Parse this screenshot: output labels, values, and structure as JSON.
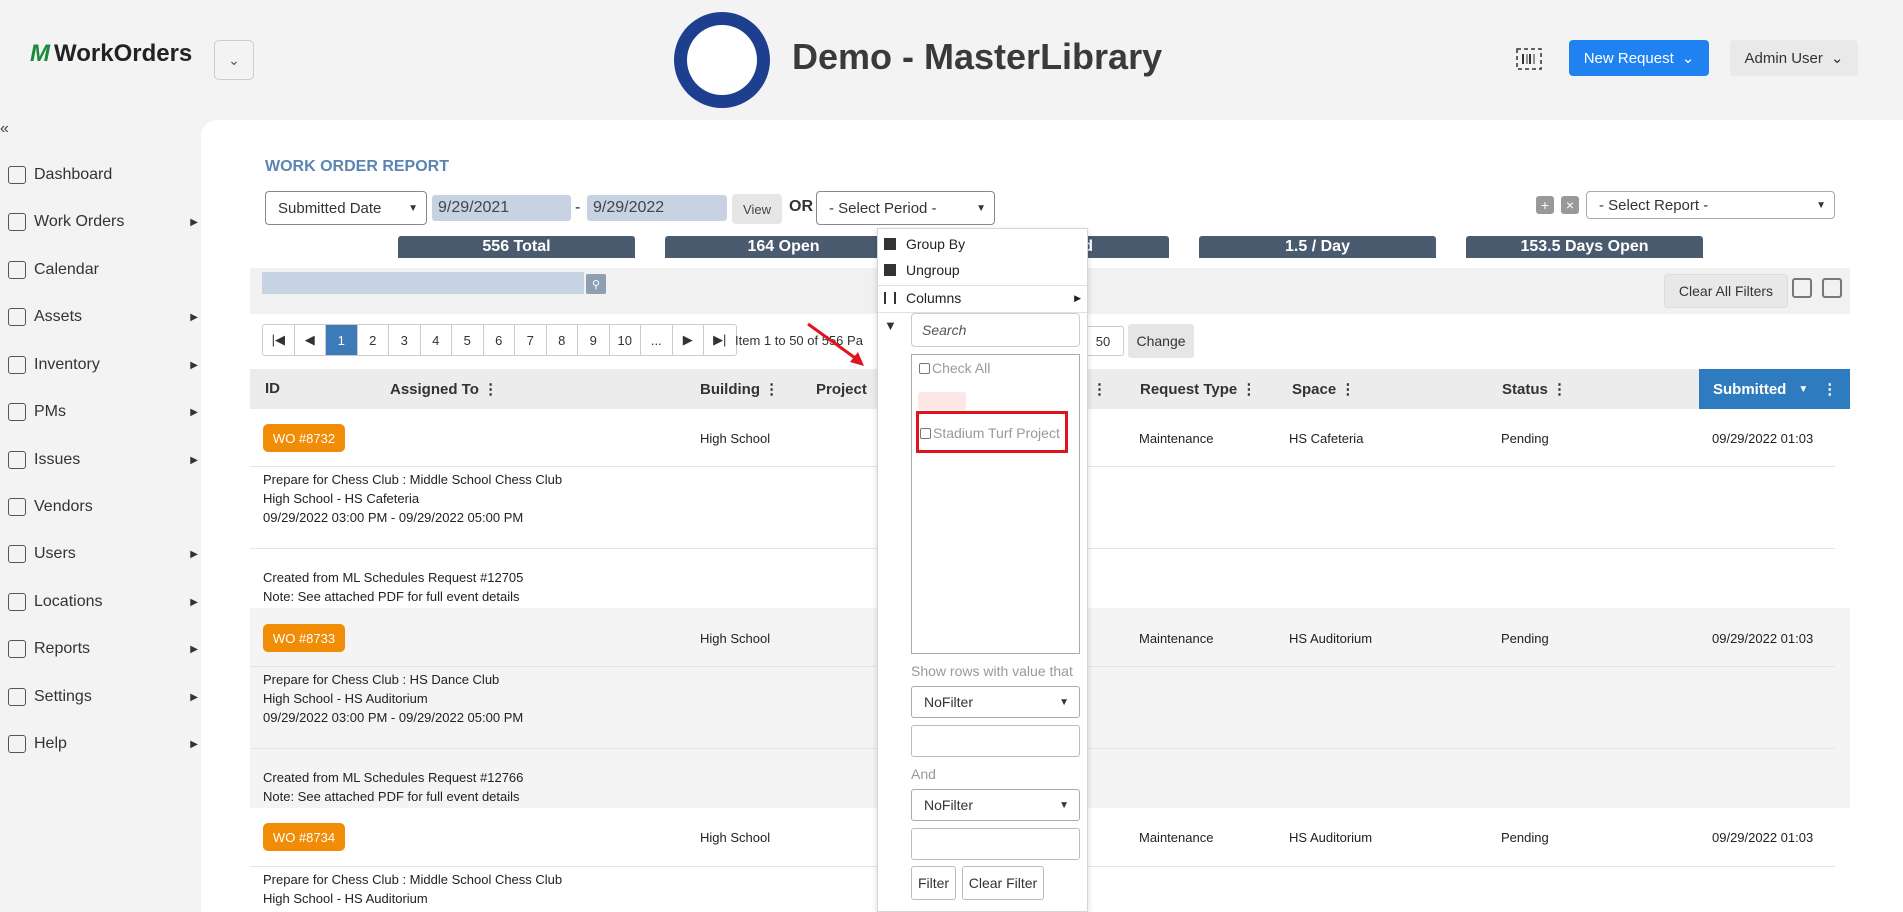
{
  "header": {
    "logo_text": "WorkOrders",
    "site_title": "Demo - MasterLibrary",
    "new_request": "New Request",
    "user": "Admin User"
  },
  "sidebar": {
    "items": [
      {
        "label": "Dashboard",
        "arrow": false
      },
      {
        "label": "Work Orders",
        "arrow": true
      },
      {
        "label": "Calendar",
        "arrow": false
      },
      {
        "label": "Assets",
        "arrow": true
      },
      {
        "label": "Inventory",
        "arrow": true
      },
      {
        "label": "PMs",
        "arrow": true
      },
      {
        "label": "Issues",
        "arrow": true
      },
      {
        "label": "Vendors",
        "arrow": false
      },
      {
        "label": "Users",
        "arrow": true
      },
      {
        "label": "Locations",
        "arrow": true
      },
      {
        "label": "Reports",
        "arrow": true
      },
      {
        "label": "Settings",
        "arrow": true
      },
      {
        "label": "Help",
        "arrow": true
      }
    ]
  },
  "report": {
    "title": "WORK ORDER REPORT",
    "date_field": "Submitted Date",
    "date_from": "9/29/2021",
    "date_sep": "-",
    "date_to": "9/29/2022",
    "view": "View",
    "or": "OR",
    "period": "- Select Period -",
    "select_report": "- Select Report -",
    "stats": [
      "556 Total",
      "164 Open",
      "d",
      "1.5 / Day",
      "153.5 Days Open"
    ],
    "clear_all": "Clear All Filters"
  },
  "pager": {
    "pages": [
      "1",
      "2",
      "3",
      "4",
      "5",
      "6",
      "7",
      "8",
      "9",
      "10",
      "..."
    ],
    "item_info": "Item 1 to 50 of 556   Pa",
    "page_size": "50",
    "change": "Change"
  },
  "columns": {
    "id": "ID",
    "assigned_to": "Assigned To",
    "building": "Building",
    "project": "Project",
    "request_type": "Request Type",
    "space": "Space",
    "status": "Status",
    "submitted": "Submitted"
  },
  "rows": [
    {
      "wo": "WO #8732",
      "building": "High School",
      "request_type": "Maintenance",
      "space": "HS Cafeteria",
      "status": "Pending",
      "submitted": "09/29/2022 01:03",
      "desc1": "Prepare for Chess Club : Middle School Chess Club",
      "desc2": "High School - HS Cafeteria",
      "desc3": "09/29/2022 03:00 PM - 09/29/2022 05:00 PM",
      "note1": "Created from ML Schedules Request #12705",
      "note2": "Note: See attached PDF for full event details"
    },
    {
      "wo": "WO #8733",
      "building": "High School",
      "request_type": "Maintenance",
      "space": "HS Auditorium",
      "status": "Pending",
      "submitted": "09/29/2022 01:03",
      "desc1": "Prepare for Chess Club : HS Dance Club",
      "desc2": "High School - HS Auditorium",
      "desc3": "09/29/2022 03:00 PM - 09/29/2022 05:00 PM",
      "note1": "Created from ML Schedules Request #12766",
      "note2": "Note: See attached PDF for full event details"
    },
    {
      "wo": "WO #8734",
      "building": "High School",
      "request_type": "Maintenance",
      "space": "HS Auditorium",
      "status": "Pending",
      "submitted": "09/29/2022 01:03",
      "desc1": "Prepare for Chess Club : Middle School Chess Club",
      "desc2": "High School - HS Auditorium"
    }
  ],
  "menu": {
    "group_by": "Group By",
    "ungroup": "Ungroup",
    "columns": "Columns",
    "search_placeholder": "Search",
    "check_all": "Check All",
    "option_1": "Stadium Turf Project",
    "show_rows": "Show rows with value that",
    "nofilter_1": "NoFilter",
    "and": "And",
    "nofilter_2": "NoFilter",
    "filter": "Filter",
    "clear_filter": "Clear Filter"
  },
  "colors": {
    "accent": "#1f82f0",
    "badge": "#f08c05",
    "sorted_header": "#2f7bc0",
    "highlight": "#e0141e"
  }
}
